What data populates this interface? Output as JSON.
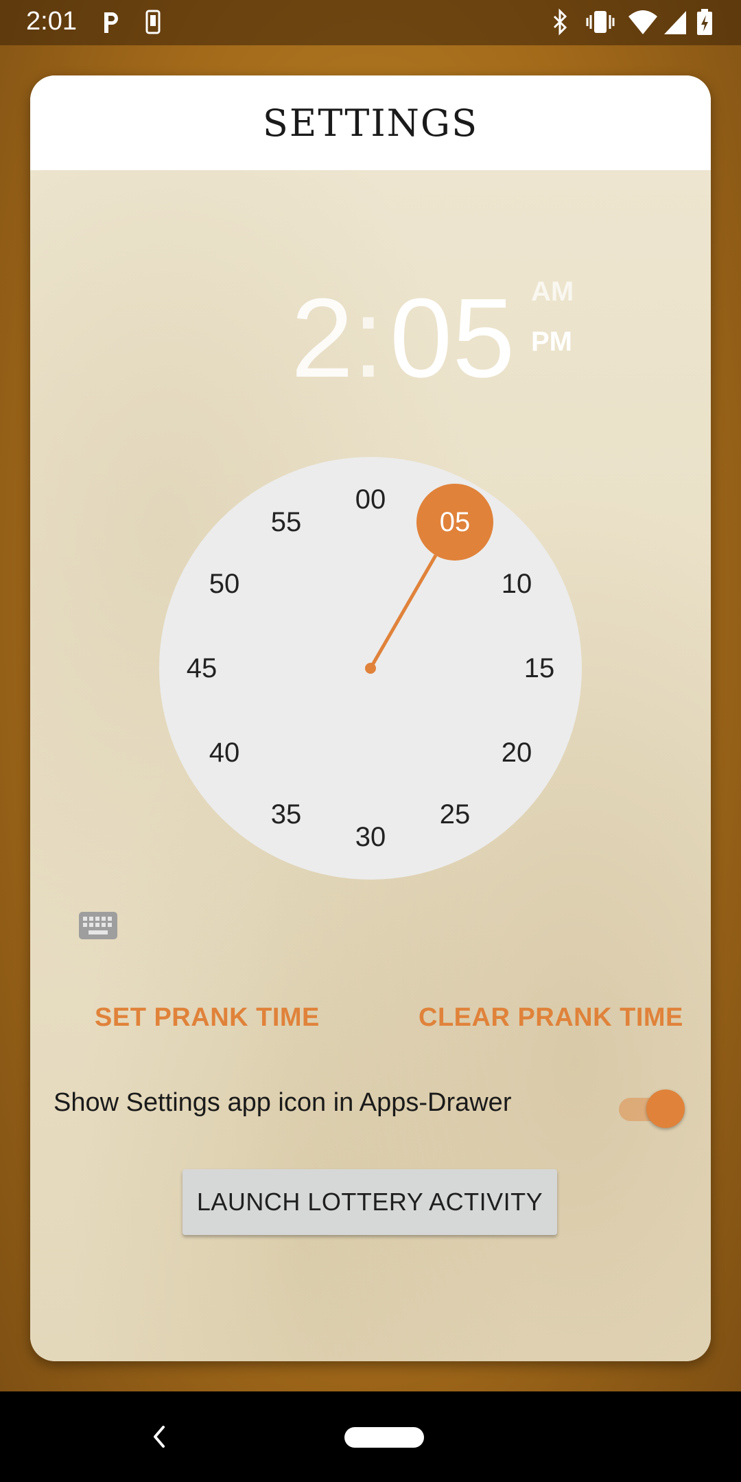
{
  "status_bar": {
    "time": "2:01",
    "icons": [
      "parking-icon",
      "phone-sim-icon",
      "bluetooth-icon",
      "vibrate-icon",
      "wifi-icon",
      "signal-icon",
      "battery-icon"
    ]
  },
  "settings": {
    "title": "SETTINGS",
    "time_picker": {
      "hour": "2",
      "separator": ":",
      "minute": "05",
      "am_label": "AM",
      "pm_label": "PM",
      "selected_period": "PM",
      "selected_minute": "05",
      "dial_numbers": [
        "00",
        "05",
        "10",
        "15",
        "20",
        "25",
        "30",
        "35",
        "40",
        "45",
        "50",
        "55"
      ]
    },
    "keyboard_toggle_icon": "keyboard-icon",
    "set_prank_time_label": "SET PRANK TIME",
    "clear_prank_time_label": "CLEAR PRANK TIME",
    "show_icon_label": "Show Settings app icon in Apps-Drawer",
    "show_icon_enabled": true,
    "launch_lottery_label": "LAUNCH LOTTERY ACTIVITY"
  },
  "colors": {
    "accent": "#e0823a",
    "background": "#a2691a",
    "card_body": "#ebe3cc"
  },
  "nav_bar": {
    "icons": [
      "back-icon",
      "home-pill-icon"
    ]
  }
}
